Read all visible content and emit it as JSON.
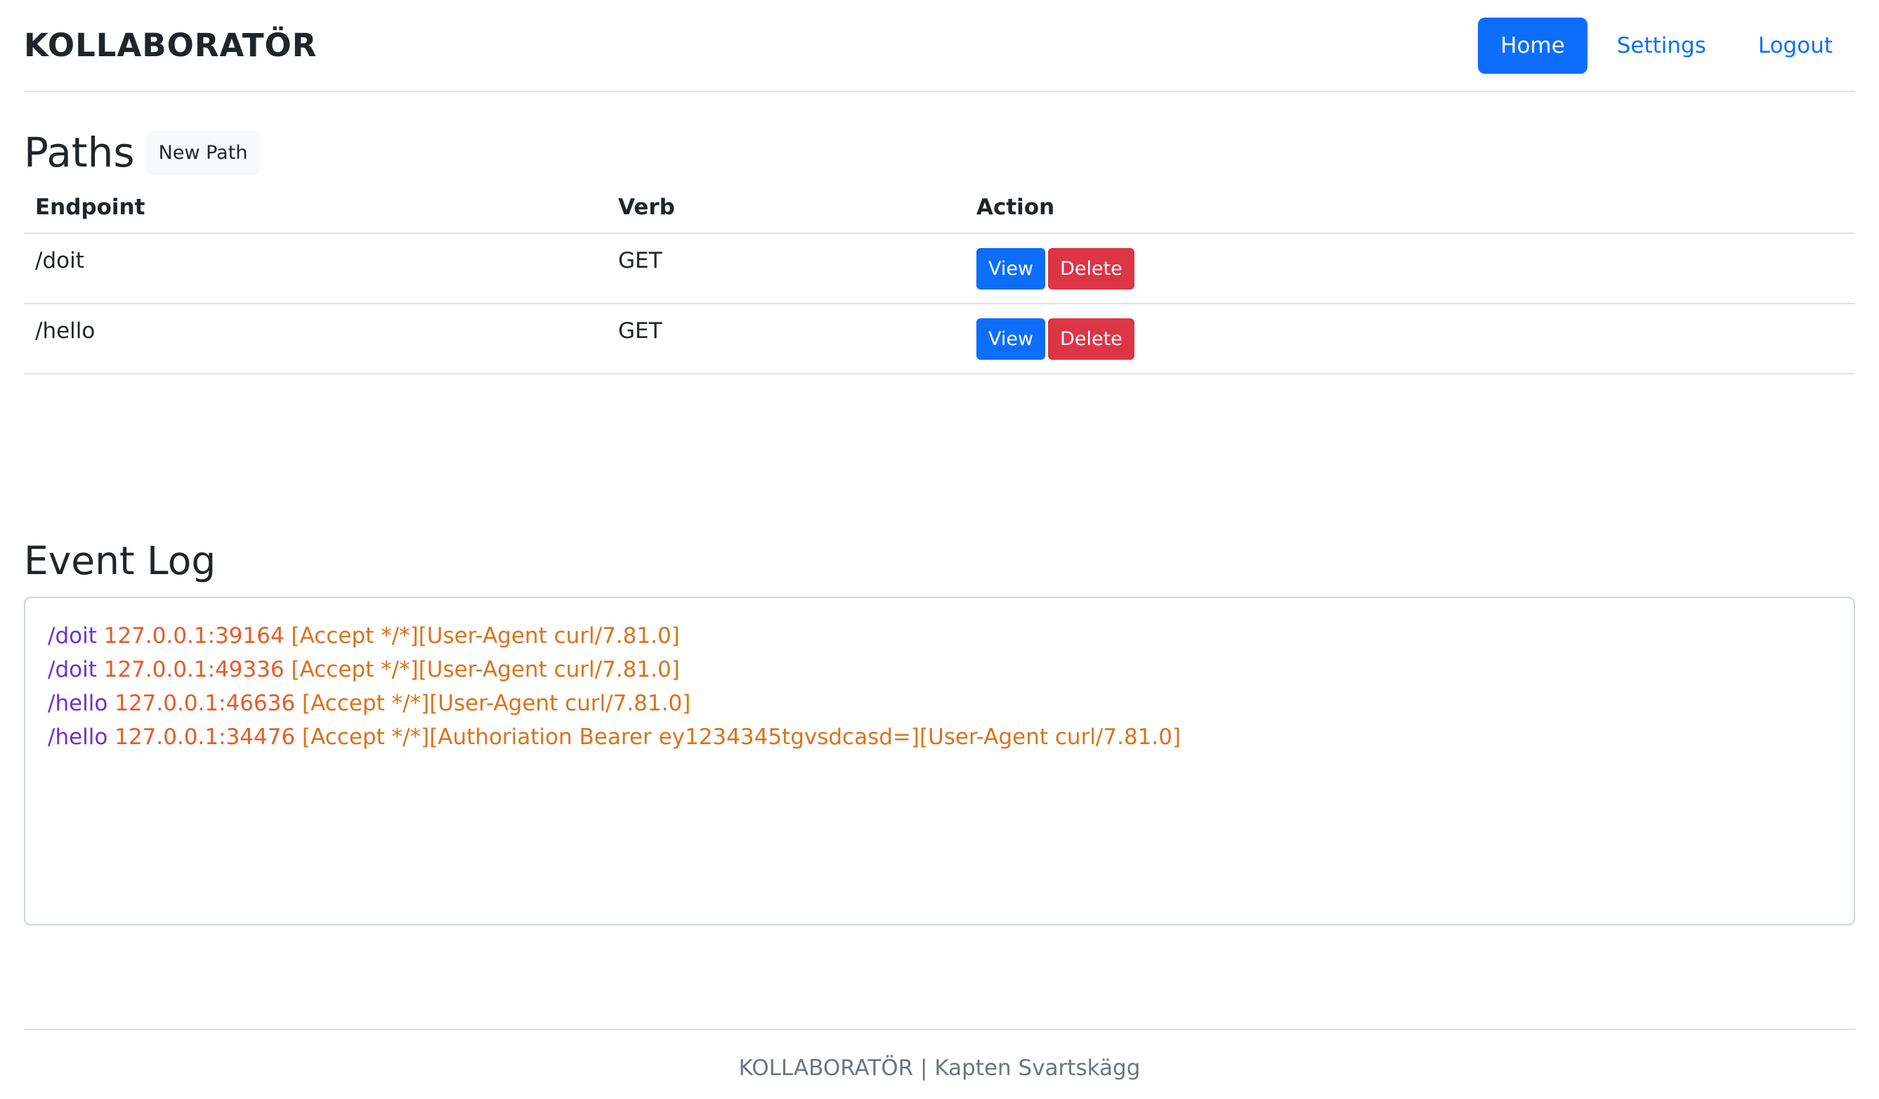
{
  "header": {
    "brand": "KOLLABORATÖR",
    "nav": [
      {
        "label": "Home",
        "active": true
      },
      {
        "label": "Settings",
        "active": false
      },
      {
        "label": "Logout",
        "active": false
      }
    ]
  },
  "paths": {
    "title": "Paths",
    "new_path_label": "New Path",
    "columns": [
      "Endpoint",
      "Verb",
      "Action"
    ],
    "rows": [
      {
        "endpoint": "/doit",
        "verb": "GET",
        "view_label": "View",
        "delete_label": "Delete"
      },
      {
        "endpoint": "/hello",
        "verb": "GET",
        "view_label": "View",
        "delete_label": "Delete"
      }
    ]
  },
  "event_log": {
    "title": "Event Log",
    "entries": [
      {
        "path": "/doit",
        "addr": "127.0.0.1:39164",
        "headers": "[Accept */*][User-Agent curl/7.81.0]"
      },
      {
        "path": "/doit",
        "addr": "127.0.0.1:49336",
        "headers": "[Accept */*][User-Agent curl/7.81.0]"
      },
      {
        "path": "/hello",
        "addr": "127.0.0.1:46636",
        "headers": "[Accept */*][User-Agent curl/7.81.0]"
      },
      {
        "path": "/hello",
        "addr": "127.0.0.1:34476",
        "headers": "[Accept */*][Authoriation Bearer ey1234345tgvsdcasd=][User-Agent curl/7.81.0]"
      }
    ]
  },
  "footer": {
    "text": "KOLLABORATÖR | Kapten Svartskägg"
  },
  "colors": {
    "primary": "#0d6efd",
    "danger": "#dc3545",
    "log_path": "#6f2fd6",
    "log_addr": "#e35d2a",
    "log_headers": "#d9731b"
  }
}
